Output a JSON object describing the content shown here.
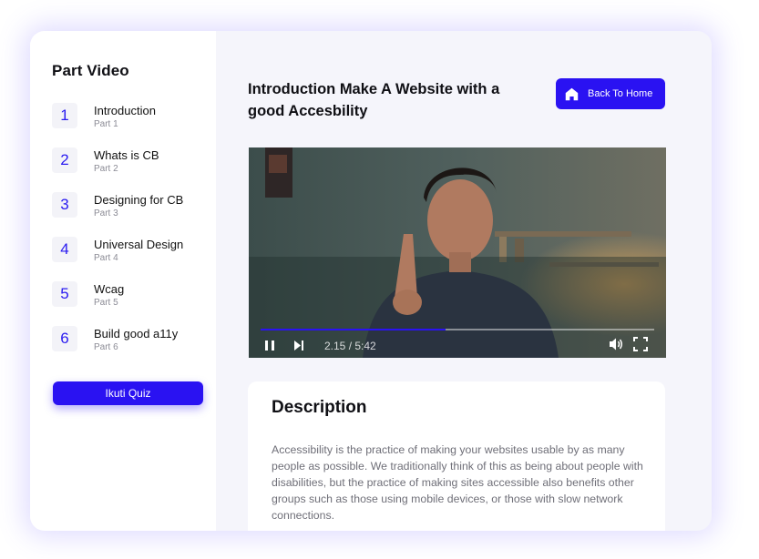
{
  "sidebar": {
    "title": "Part Video",
    "parts": [
      {
        "num": "1",
        "title": "Introduction",
        "sub": "Part 1"
      },
      {
        "num": "2",
        "title": "Whats is CB",
        "sub": "Part 2"
      },
      {
        "num": "3",
        "title": "Designing for CB",
        "sub": "Part 3"
      },
      {
        "num": "4",
        "title": "Universal Design",
        "sub": "Part 4"
      },
      {
        "num": "5",
        "title": "Wcag",
        "sub": "Part 5"
      },
      {
        "num": "6",
        "title": "Build good a11y",
        "sub": "Part 6"
      }
    ],
    "quiz_label": "Ikuti Quiz"
  },
  "main": {
    "title": "Introduction Make A Website with a good Accesbility",
    "home_label": "Back To Home",
    "video": {
      "time": "2.15 / 5:42",
      "progress": 0.47
    },
    "description": {
      "title": "Description",
      "body": "Accessibility is the practice of making your websites usable by as many people as possible. We traditionally think of this as being about people with disabilities, but the practice of making sites accessible also benefits other groups such as those using mobile devices, or those with slow network connections."
    }
  },
  "colors": {
    "accent": "#2a12f2",
    "sidebar_bg": "#ffffff",
    "main_bg": "#f5f5fb"
  }
}
